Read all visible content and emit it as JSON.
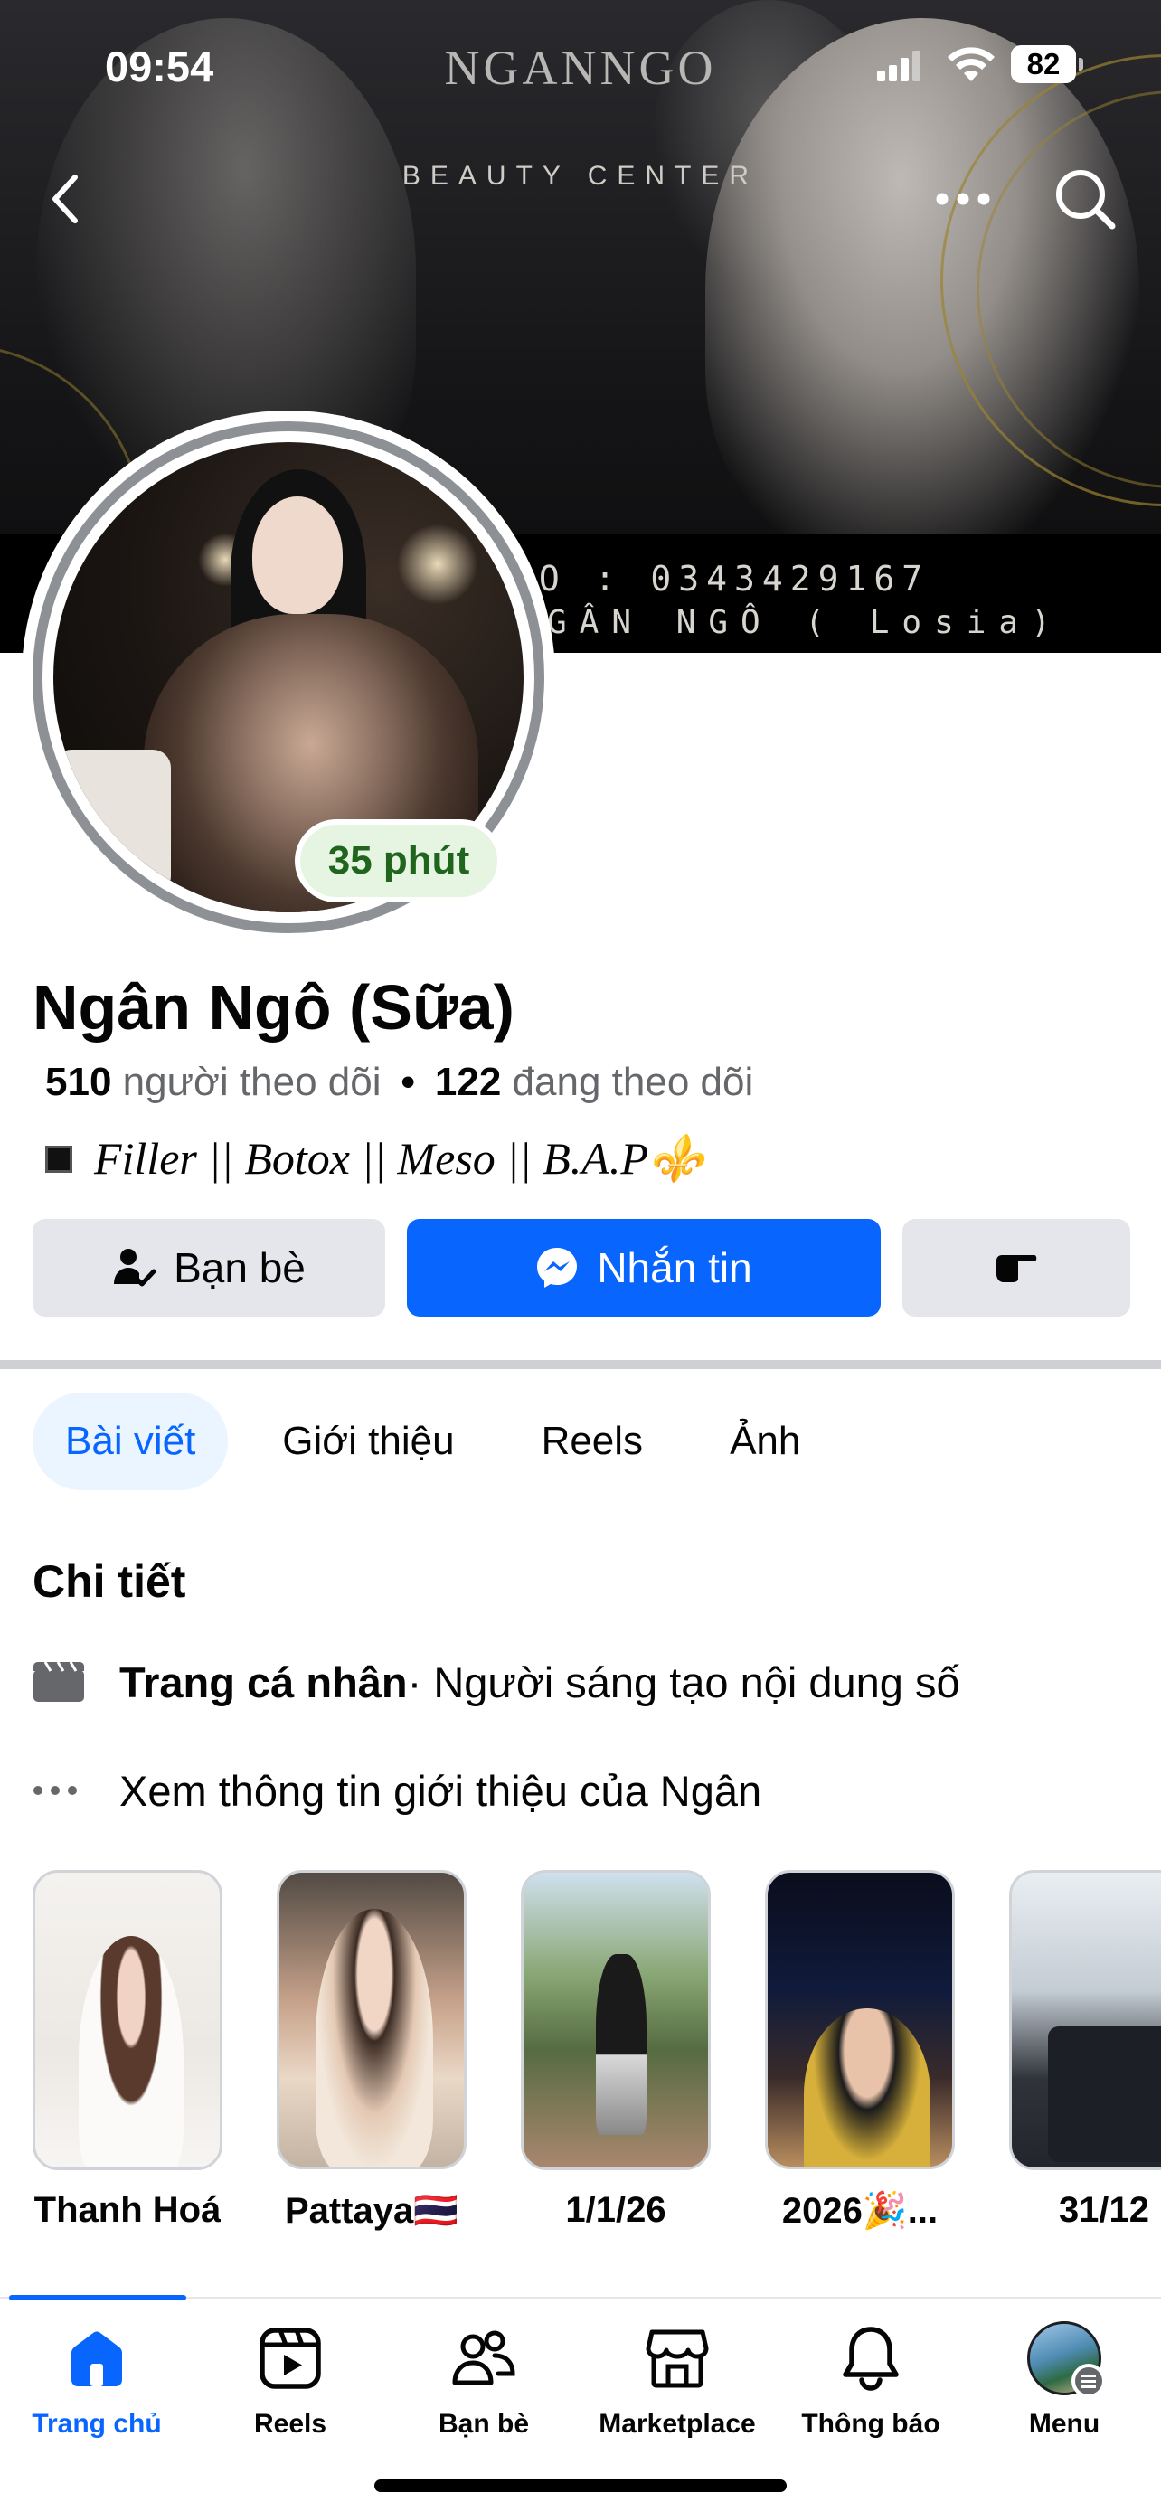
{
  "status_bar": {
    "time": "09:54",
    "battery": "82"
  },
  "cover": {
    "brand": "NGANNGO",
    "brand_sub": "BEAUTY CENTER",
    "line1": "LO : 0343429167",
    "line2": "GÂN NGÔ ( Losia)"
  },
  "profile": {
    "name": "Ngân Ngô (Sữa)",
    "active_badge": "35 phút",
    "followers_count": "510",
    "followers_label": "người theo dõi",
    "following_count": "122",
    "following_label": "đang theo dõi",
    "bio": "Filler || Botox || Meso || B.A.P⚜️"
  },
  "actions": {
    "friends_label": "Bạn bè",
    "message_label": "Nhắn tin"
  },
  "tabs": [
    {
      "label": "Bài viết",
      "active": true
    },
    {
      "label": "Giới thiệu",
      "active": false
    },
    {
      "label": "Reels",
      "active": false
    },
    {
      "label": "Ảnh",
      "active": false
    }
  ],
  "details": {
    "title": "Chi tiết",
    "page_type_bold": "Trang cá nhân",
    "page_type_rest": " · Người sáng tạo nội dung số",
    "see_about": "Xem thông tin giới thiệu của Ngân"
  },
  "highlights": [
    {
      "label": "Thanh Hoá"
    },
    {
      "label": "Pattaya🇹🇭"
    },
    {
      "label": "1/1/26"
    },
    {
      "label": "2026🎉..."
    },
    {
      "label": "31/12"
    }
  ],
  "bottom_nav": [
    {
      "label": "Trang chủ",
      "icon": "home-icon",
      "active": true
    },
    {
      "label": "Reels",
      "icon": "reels-icon",
      "active": false
    },
    {
      "label": "Bạn bè",
      "icon": "friends-icon",
      "active": false
    },
    {
      "label": "Marketplace",
      "icon": "marketplace-icon",
      "active": false
    },
    {
      "label": "Thông báo",
      "icon": "bell-icon",
      "active": false
    },
    {
      "label": "Menu",
      "icon": "menu-avatar",
      "active": false
    }
  ],
  "colors": {
    "accent": "#0866ff",
    "badge_green": "#20651e",
    "tab_active_bg": "#ebf5ff"
  }
}
